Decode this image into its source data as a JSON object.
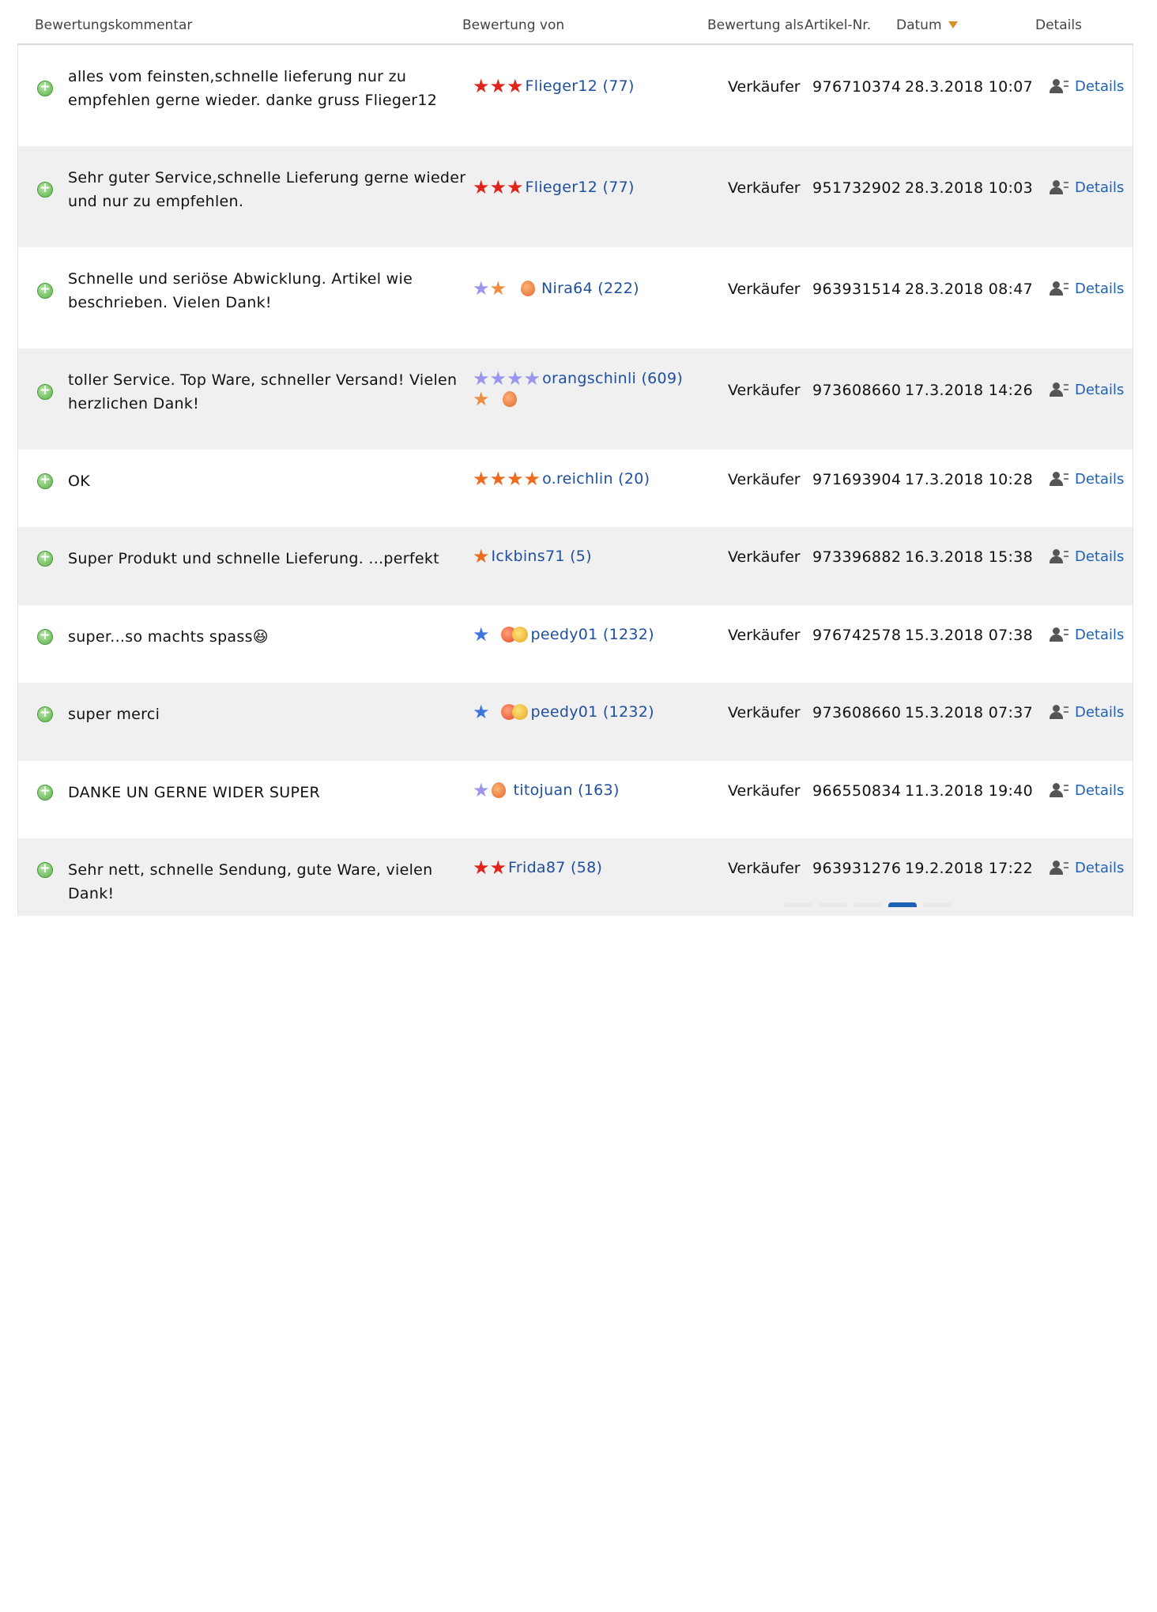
{
  "header": {
    "comment": "Bewertungskommentar",
    "from": "Bewertung von",
    "as": "Bewertung als",
    "article": "Artikel-Nr.",
    "date": "Datum",
    "details": "Details"
  },
  "rows": [
    {
      "comment": "alles vom feinsten,schnelle lieferung nur zu empfehlen gerne wieder. danke gruss Flieger12",
      "user": "Flieger12 (77)",
      "role": "Verkäufer",
      "article": "976710374",
      "date": "28.3.2018 10:07",
      "details": "Details"
    },
    {
      "comment": "Sehr guter Service,schnelle Lieferung gerne wieder und nur zu empfehlen.",
      "user": "Flieger12 (77)",
      "role": "Verkäufer",
      "article": "951732902",
      "date": "28.3.2018 10:03",
      "details": "Details"
    },
    {
      "comment": "Schnelle und seriöse Abwicklung. Artikel wie beschrieben. Vielen Dank!",
      "user": "Nira64 (222)",
      "role": "Verkäufer",
      "article": "963931514",
      "date": "28.3.2018 08:47",
      "details": "Details"
    },
    {
      "comment": "toller Service. Top Ware, schneller Versand! Vielen herzlichen Dank!",
      "user": "orangschinli (609)",
      "role": "Verkäufer",
      "article": "973608660",
      "date": "17.3.2018 14:26",
      "details": "Details"
    },
    {
      "comment": "OK",
      "user": "o.reichlin (20)",
      "role": "Verkäufer",
      "article": "971693904",
      "date": "17.3.2018 10:28",
      "details": "Details"
    },
    {
      "comment": "Super Produkt und schnelle Lieferung. ...perfekt",
      "user": "Ickbins71 (5)",
      "role": "Verkäufer",
      "article": "973396882",
      "date": "16.3.2018 15:38",
      "details": "Details"
    },
    {
      "comment": "super...so machts spass😆",
      "user": "peedy01 (1232)",
      "role": "Verkäufer",
      "article": "976742578",
      "date": "15.3.2018 07:38",
      "details": "Details"
    },
    {
      "comment": "super merci",
      "user": "peedy01 (1232)",
      "role": "Verkäufer",
      "article": "973608660",
      "date": "15.3.2018 07:37",
      "details": "Details"
    },
    {
      "comment": "DANKE UN GERNE WIDER SUPER",
      "user": "titojuan (163)",
      "role": "Verkäufer",
      "article": "966550834",
      "date": "11.3.2018 19:40",
      "details": "Details"
    },
    {
      "comment": "Sehr nett, schnelle Sendung, gute Ware, vielen Dank!",
      "user": "Frida87 (58)",
      "role": "Verkäufer",
      "article": "963931276",
      "date": "19.2.2018 17:22",
      "details": "Details"
    }
  ],
  "icons": {
    "positive": "plus-circle-icon",
    "details": "person-details-icon",
    "sort": "sort-desc-icon"
  },
  "colors": {
    "link": "#1e4fa0",
    "alt_row": "#f0f0f0",
    "positive": "#5cb14a",
    "sort_arrow": "#d8902a"
  },
  "pagination": {
    "active_index": 3,
    "count": 5
  }
}
